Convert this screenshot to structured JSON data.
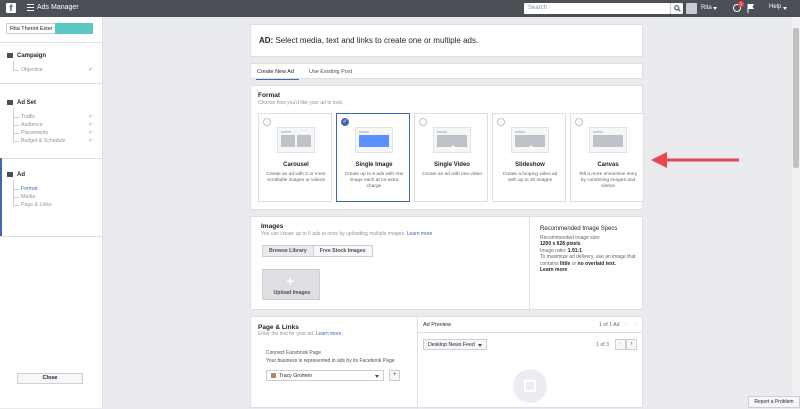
{
  "topbar": {
    "app_title": "Ads Manager",
    "search_placeholder": "Search",
    "user_name": "Rita",
    "notification_count": "1",
    "help_label": "Help"
  },
  "sidebar": {
    "account_name": "Rita Theriot Ester",
    "campaign": {
      "title": "Campaign",
      "items": [
        "Objective"
      ]
    },
    "adset": {
      "title": "Ad Set",
      "items": [
        "Traffic",
        "Audience",
        "Placements",
        "Budget & Schedule"
      ]
    },
    "ad": {
      "title": "Ad",
      "items": [
        "Format",
        "Media",
        "Page & Links"
      ]
    },
    "close_label": "Close",
    "check_mark": "✓"
  },
  "header": {
    "bold": "AD:",
    "text": " Select media, text and links to create one or multiple ads."
  },
  "tabs": [
    "Create New Ad",
    "Use Existing Post"
  ],
  "format": {
    "title": "Format",
    "subtitle": "Choose how you'd like your ad to look.",
    "options": [
      {
        "title": "Carousel",
        "desc": "Create an ad with 2 or more scrollable images or videos",
        "selected": false
      },
      {
        "title": "Single Image",
        "desc": "Create up to 6 ads with one image each at no extra charge",
        "selected": true
      },
      {
        "title": "Single Video",
        "desc": "Create an ad with one video",
        "selected": false
      },
      {
        "title": "Slideshow",
        "desc": "Create a looping video ad with up to 10 images",
        "selected": false
      },
      {
        "title": "Canvas",
        "desc": "Tell a more immersive story by combining images and videos",
        "selected": false
      }
    ]
  },
  "images": {
    "title": "Images",
    "subtitle": "You can create up to 6 ads at once by uploading multiple images.",
    "learn_more": "Learn more",
    "browse_label": "Browse Library",
    "stock_label": "Free Stock Images",
    "upload_label": "Upload Images",
    "specs": {
      "title": "Recommended Image Specs",
      "size_label": "Recommended image size:",
      "size_value": "1200 x 628 pixels",
      "ratio_label": "Image ratio:",
      "ratio_value": "1.91:1",
      "tip_1": "To maximize ad delivery, use an image that contains",
      "tip_little": "little",
      "tip_or": "or",
      "tip_no": "no overlaid text.",
      "learn_more": "Learn more"
    }
  },
  "page_links": {
    "title": "Page & Links",
    "subtitle": "Enter the text for your ad.",
    "learn_more": "Learn more.",
    "connect_label": "Connect Facebook Page",
    "connect_desc": "Your business is represented in ads by its Facebook Page.",
    "page_value": "Tracy Gromen",
    "add_label": "+"
  },
  "preview": {
    "title": "Ad Preview",
    "count": "1 of 1 Ad",
    "placement": "Desktop News Feed",
    "page": "1 of 3"
  },
  "footer": {
    "report_label": "Report a Problem"
  },
  "colors": {
    "accent": "#4267b2",
    "topbar": "#4b4f56",
    "arrow": "#e8464e",
    "teal": "#5bc8c4"
  }
}
